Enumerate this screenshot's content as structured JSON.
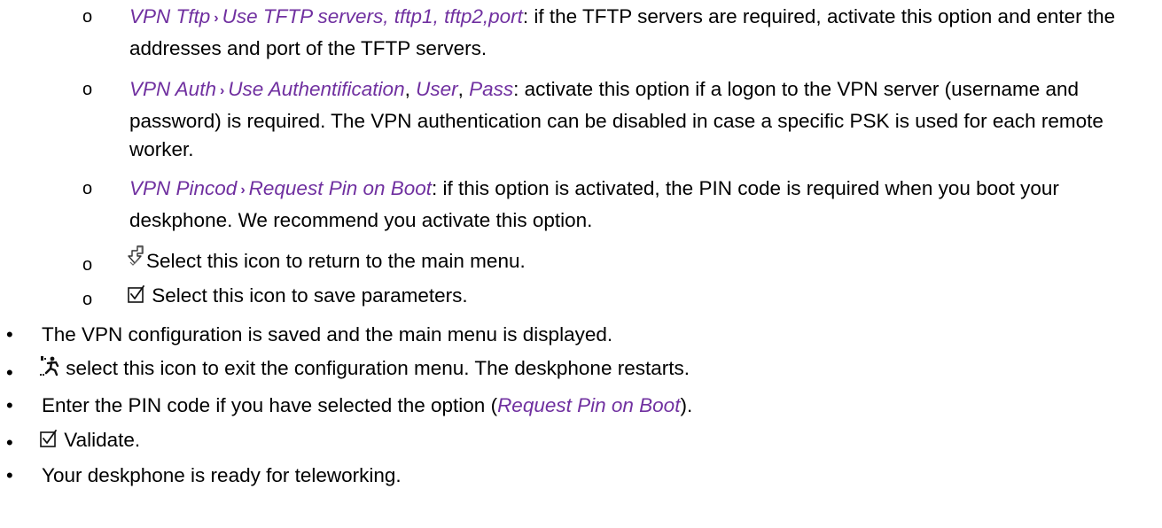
{
  "sub_items": [
    {
      "marker": "o",
      "path1": "VPN Tftp",
      "sep": "›",
      "path2": "Use TFTP servers, tftp1, tftp2,port",
      "rest": ": if the TFTP servers are required, activate this option and enter the addresses and port of the TFTP servers."
    },
    {
      "marker": "o",
      "path1": "VPN Auth",
      "sep": "›",
      "path2": "Use Authentification",
      "comma1": ", ",
      "path3": "User",
      "comma2": ", ",
      "path4": "Pass",
      "rest": ": activate this option if a logon to the VPN server (username and password) is required. The VPN authentication can be disabled in case a specific PSK is used for each remote worker."
    },
    {
      "marker": "o",
      "path1": "VPN Pincod",
      "sep": "›",
      "path2": "Request Pin on Boot",
      "rest": ": if this option is activated, the PIN code is required when you boot your deskphone. We recommend you activate this option."
    },
    {
      "marker": "o",
      "icon": "return-arrow-icon",
      "rest": "Select this icon to return to the main menu."
    },
    {
      "marker": "o",
      "icon": "checkbox-validate-icon",
      "rest": " Select this icon to save parameters."
    }
  ],
  "items": [
    {
      "marker": "•",
      "text": "The VPN configuration is saved and the main menu is displayed."
    },
    {
      "marker": "•",
      "icon": "exit-running-man-icon",
      "text": " select this icon to exit the configuration menu. The deskphone restarts."
    },
    {
      "marker": "•",
      "pre": "Enter the PIN code if you have selected the option (",
      "link": "Request Pin on Boot",
      "post": ")."
    },
    {
      "marker": "•",
      "icon": "checkbox-validate-icon",
      "text": " Validate."
    },
    {
      "marker": "•",
      "text": "Your deskphone is ready for teleworking."
    }
  ],
  "colors": {
    "link": "#7030a0",
    "text": "#000000"
  }
}
